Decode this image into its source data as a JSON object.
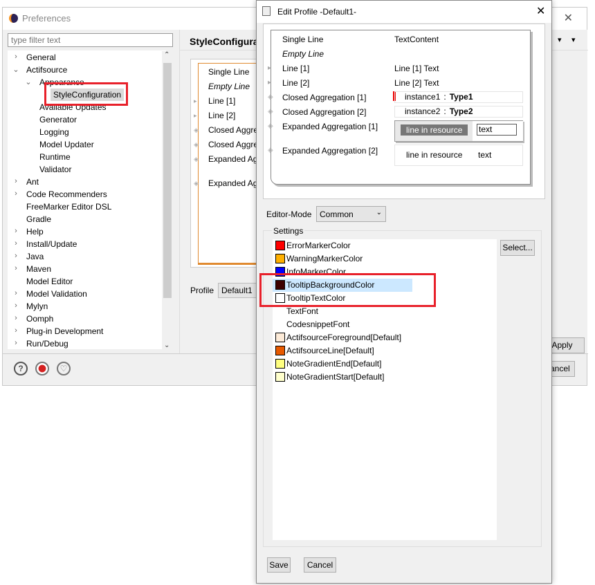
{
  "prefs": {
    "title": "Preferences",
    "filter_placeholder": "type filter text",
    "tree": [
      {
        "label": "General",
        "level": 0,
        "state": "collapsed"
      },
      {
        "label": "Actifsource",
        "level": 0,
        "state": "expanded"
      },
      {
        "label": "Appearance",
        "level": 1,
        "state": "expanded"
      },
      {
        "label": "StyleConfiguration",
        "level": 2,
        "state": "leaf",
        "selected": true
      },
      {
        "label": "Available Updates",
        "level": 1,
        "state": "leaf"
      },
      {
        "label": "Generator",
        "level": 1,
        "state": "leaf"
      },
      {
        "label": "Logging",
        "level": 1,
        "state": "leaf"
      },
      {
        "label": "Model Updater",
        "level": 1,
        "state": "leaf"
      },
      {
        "label": "Runtime",
        "level": 1,
        "state": "leaf"
      },
      {
        "label": "Validator",
        "level": 1,
        "state": "leaf"
      },
      {
        "label": "Ant",
        "level": 0,
        "state": "collapsed"
      },
      {
        "label": "Code Recommenders",
        "level": 0,
        "state": "collapsed"
      },
      {
        "label": "FreeMarker Editor DSL",
        "level": 0,
        "state": "leaf"
      },
      {
        "label": "Gradle",
        "level": 0,
        "state": "leaf"
      },
      {
        "label": "Help",
        "level": 0,
        "state": "collapsed"
      },
      {
        "label": "Install/Update",
        "level": 0,
        "state": "collapsed"
      },
      {
        "label": "Java",
        "level": 0,
        "state": "collapsed"
      },
      {
        "label": "Maven",
        "level": 0,
        "state": "collapsed"
      },
      {
        "label": "Model Editor",
        "level": 0,
        "state": "leaf"
      },
      {
        "label": "Model Validation",
        "level": 0,
        "state": "collapsed"
      },
      {
        "label": "Mylyn",
        "level": 0,
        "state": "collapsed"
      },
      {
        "label": "Oomph",
        "level": 0,
        "state": "collapsed"
      },
      {
        "label": "Plug-in Development",
        "level": 0,
        "state": "collapsed"
      },
      {
        "label": "Run/Debug",
        "level": 0,
        "state": "collapsed"
      }
    ],
    "page_title": "StyleConfigurati",
    "preview_rows": [
      "Single Line",
      "Empty Line",
      "Line [1]",
      "Line [2]",
      "Closed Aggre",
      "Closed Aggre",
      "Expanded Ag",
      "Expanded Ag"
    ],
    "profile_label": "Profile",
    "profile_value": "Default1",
    "apply_label": "Apply",
    "cancel_label": "Cancel"
  },
  "dialog": {
    "title": "Edit Profile -Default1-",
    "preview": {
      "left": [
        "Single Line",
        "Empty Line",
        "Line [1]",
        "Line [2]",
        "Closed Aggregation [1]",
        "Closed Aggregation [2]",
        "Expanded Aggregation [1]",
        "Expanded Aggregation [2]"
      ],
      "text_content": "TextContent",
      "line1_text": "Line [1] Text",
      "line2_text": "Line [2] Text",
      "instance1": "instance1",
      "type1": "Type1",
      "instance2": "instance2",
      "type2": "Type2",
      "colon": ":",
      "line_in_resource": "line in resource",
      "text": "text"
    },
    "editor_mode_label": "Editor-Mode",
    "editor_mode_value": "Common",
    "settings_label": "Settings",
    "settings": [
      {
        "label": "ErrorMarkerColor",
        "color": "#ff0000"
      },
      {
        "label": "WarningMarkerColor",
        "color": "#ffb000"
      },
      {
        "label": "InfoMarkerColor",
        "color": "#0000ff"
      },
      {
        "label": "TooltipBackgroundColor",
        "color": "#3c0000",
        "selected": true
      },
      {
        "label": "TooltipTextColor",
        "color": "#ffffff"
      },
      {
        "label": "TextFont"
      },
      {
        "label": "CodesnippetFont"
      },
      {
        "label": "ActifsourceForeground[Default]",
        "color": "#fdebd8"
      },
      {
        "label": "ActifsourceLine[Default]",
        "color": "#e85a00"
      },
      {
        "label": "NoteGradientEnd[Default]",
        "color": "#ffff80"
      },
      {
        "label": "NoteGradientStart[Default]",
        "color": "#ffffcc"
      }
    ],
    "select_label": "Select...",
    "save_label": "Save",
    "cancel_label": "Cancel"
  }
}
